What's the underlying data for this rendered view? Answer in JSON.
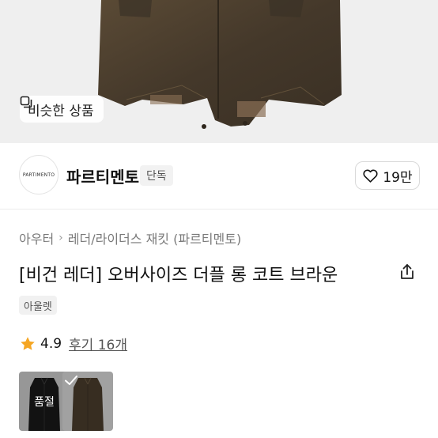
{
  "hero": {
    "similar_button_label": "비슷한 상품"
  },
  "brand": {
    "logo_text": "PARTIMENTO",
    "name": "파르티멘토",
    "badge": "단독",
    "like_count": "19만"
  },
  "breadcrumb": {
    "items": [
      "아우터",
      "레더/라이더스 재킷 (파르티멘토)"
    ]
  },
  "product": {
    "title": "[비건 레더] 오버사이즈 더플 롱 코트 브라운",
    "tag": "아울렛",
    "rating": "4.9",
    "reviews_label": "후기 16개"
  },
  "options": [
    {
      "label": "품절",
      "state": "soldout",
      "color": "black"
    },
    {
      "label": "",
      "state": "selected",
      "color": "brown"
    }
  ],
  "colors": {
    "leather_brown": "#4a3d2c",
    "star": "#f5a623"
  }
}
